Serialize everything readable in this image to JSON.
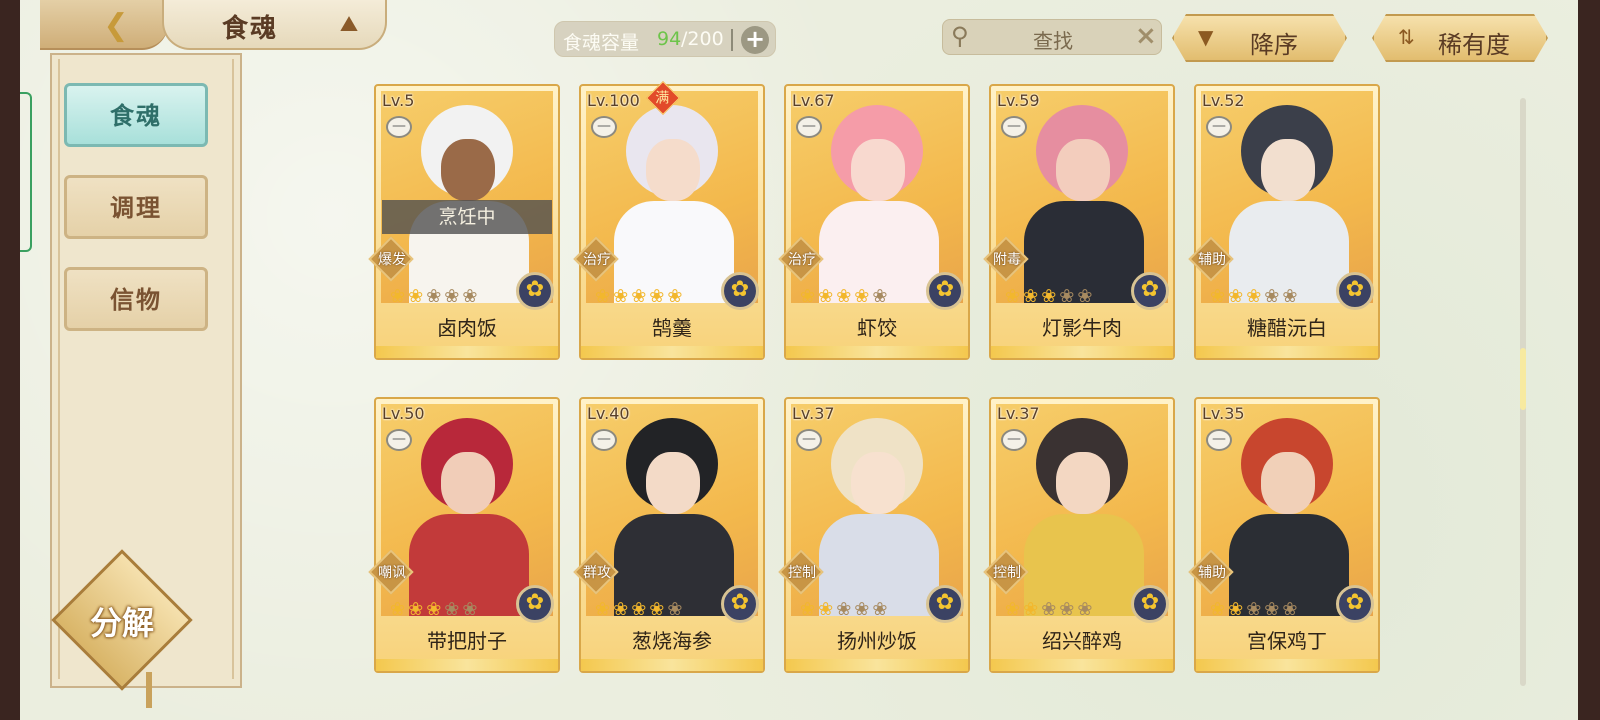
{
  "header": {
    "title": "食魂",
    "capacity_label": "食魂容量",
    "capacity_current": "94",
    "capacity_max": "/200",
    "search_label": "查找",
    "sort_order_label": "降序",
    "sort_by_label": "稀有度"
  },
  "sidebar": {
    "items": [
      {
        "label": "食魂",
        "active": true
      },
      {
        "label": "调理",
        "active": false
      },
      {
        "label": "信物",
        "active": false
      }
    ],
    "decompose_label": "分解"
  },
  "cards": [
    {
      "level": "Lv.5",
      "name": "卤肉饭",
      "role": "爆发",
      "stars": 2,
      "max": false,
      "status": "烹饪中",
      "art_colors": [
        "#f2f2f2",
        "#9a6a48",
        "#f7f4ee"
      ]
    },
    {
      "level": "Lv.100",
      "name": "鹄羹",
      "role": "治疗",
      "stars": 5,
      "max": true,
      "max_label": "满",
      "art_colors": [
        "#e9e6ef",
        "#f5dccb",
        "#f9f9fb"
      ]
    },
    {
      "level": "Lv.67",
      "name": "虾饺",
      "role": "治疗",
      "stars": 4,
      "max": false,
      "art_colors": [
        "#f59ca8",
        "#f8d9cf",
        "#fbeff0"
      ]
    },
    {
      "level": "Lv.59",
      "name": "灯影牛肉",
      "role": "附毒",
      "stars": 3,
      "max": false,
      "art_colors": [
        "#e68ea0",
        "#f3cdbd",
        "#2a2d36"
      ]
    },
    {
      "level": "Lv.52",
      "name": "糖醋沅白",
      "role": "辅助",
      "stars": 3,
      "max": false,
      "art_colors": [
        "#3b3f4a",
        "#f2dfcf",
        "#e9ecef"
      ]
    },
    {
      "level": "Lv.50",
      "name": "带把肘子",
      "role": "嘲讽",
      "stars": 3,
      "max": false,
      "art_colors": [
        "#b8283a",
        "#f1cdb8",
        "#c23a3a"
      ]
    },
    {
      "level": "Lv.40",
      "name": "葱烧海参",
      "role": "群攻",
      "stars": 4,
      "max": false,
      "art_colors": [
        "#222326",
        "#f3dac7",
        "#2e2f35"
      ]
    },
    {
      "level": "Lv.37",
      "name": "扬州炒饭",
      "role": "控制",
      "stars": 2,
      "max": false,
      "art_colors": [
        "#efe2c6",
        "#f7e1cf",
        "#d9dde8"
      ]
    },
    {
      "level": "Lv.37",
      "name": "绍兴醉鸡",
      "role": "控制",
      "stars": 2,
      "max": false,
      "art_colors": [
        "#3a3232",
        "#f3d7c2",
        "#e8c44d"
      ]
    },
    {
      "level": "Lv.35",
      "name": "宫保鸡丁",
      "role": "辅助",
      "stars": 2,
      "max": false,
      "art_colors": [
        "#c8462e",
        "#f1d0b8",
        "#2b2e34"
      ]
    }
  ]
}
